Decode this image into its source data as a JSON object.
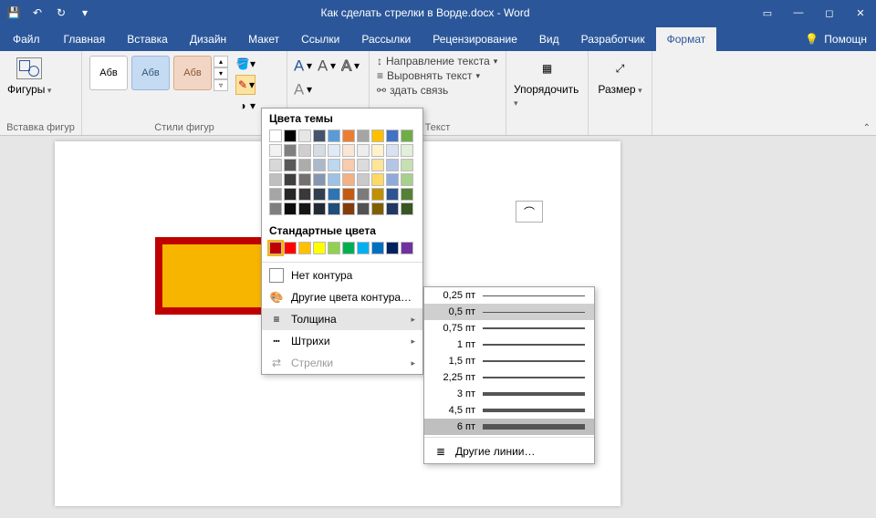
{
  "title": "Как сделать стрелки в Ворде.docx - Word",
  "tabs": {
    "file": "Файл",
    "home": "Главная",
    "insert": "Вставка",
    "design": "Дизайн",
    "layout": "Макет",
    "references": "Ссылки",
    "mailings": "Рассылки",
    "review": "Рецензирование",
    "view": "Вид",
    "developer": "Разработчик",
    "format": "Формат"
  },
  "tell_me": "Помощн",
  "groups": {
    "shapes": "Вставка фигур",
    "styles": "Стили фигур",
    "text": "Текст"
  },
  "shapes_btn": "Фигуры",
  "style_chip": "Абв",
  "arrange": "Упорядочить",
  "size": "Размер",
  "text_dir": "Направление текста",
  "align_text": "Выровнять текст",
  "create_link": "здать связь",
  "outline": {
    "theme": "Цвета темы",
    "standard": "Стандартные цвета",
    "no_outline": "Нет контура",
    "more_colors": "Другие цвета контура…",
    "weight": "Толщина",
    "dashes": "Штрихи",
    "arrows": "Стрелки"
  },
  "theme_colors": [
    [
      "#ffffff",
      "#000000",
      "#e7e6e6",
      "#44546a",
      "#5b9bd5",
      "#ed7d31",
      "#a5a5a5",
      "#ffc000",
      "#4472c4",
      "#70ad47"
    ],
    [
      "#f2f2f2",
      "#7f7f7f",
      "#d0cece",
      "#d6dce4",
      "#deeaf6",
      "#fbe5d5",
      "#ededed",
      "#fff2cc",
      "#d9e2f3",
      "#e2efd9"
    ],
    [
      "#d8d8d8",
      "#595959",
      "#aeabab",
      "#adb9ca",
      "#bdd7ee",
      "#f7cbac",
      "#dbdbdb",
      "#fee599",
      "#b4c6e7",
      "#c5e0b3"
    ],
    [
      "#bfbfbf",
      "#3f3f3f",
      "#757070",
      "#8496b0",
      "#9cc3e5",
      "#f4b183",
      "#c9c9c9",
      "#ffd965",
      "#8eaadb",
      "#a8d08d"
    ],
    [
      "#a5a5a5",
      "#262626",
      "#3a3838",
      "#323f4f",
      "#2e75b5",
      "#c55a11",
      "#7b7b7b",
      "#bf9000",
      "#2f5496",
      "#538135"
    ],
    [
      "#7f7f7f",
      "#0c0c0c",
      "#171616",
      "#222a35",
      "#1e4e79",
      "#833c0b",
      "#525252",
      "#7f6000",
      "#1f3864",
      "#375623"
    ]
  ],
  "standard_colors": [
    "#c00000",
    "#ff0000",
    "#ffc000",
    "#ffff00",
    "#92d050",
    "#00b050",
    "#00b0f0",
    "#0070c0",
    "#002060",
    "#7030a0"
  ],
  "weights": [
    {
      "label": "0,25 пт",
      "px": 0.5
    },
    {
      "label": "0,5 пт",
      "px": 1
    },
    {
      "label": "0,75 пт",
      "px": 1.3
    },
    {
      "label": "1 пт",
      "px": 1.6
    },
    {
      "label": "1,5 пт",
      "px": 2
    },
    {
      "label": "2,25 пт",
      "px": 2.6
    },
    {
      "label": "3 пт",
      "px": 3.2
    },
    {
      "label": "4,5 пт",
      "px": 4.2
    },
    {
      "label": "6 пт",
      "px": 5.4
    }
  ],
  "weight_hover_index": 1,
  "weight_active_index": 8,
  "more_lines": "Другие линии…"
}
